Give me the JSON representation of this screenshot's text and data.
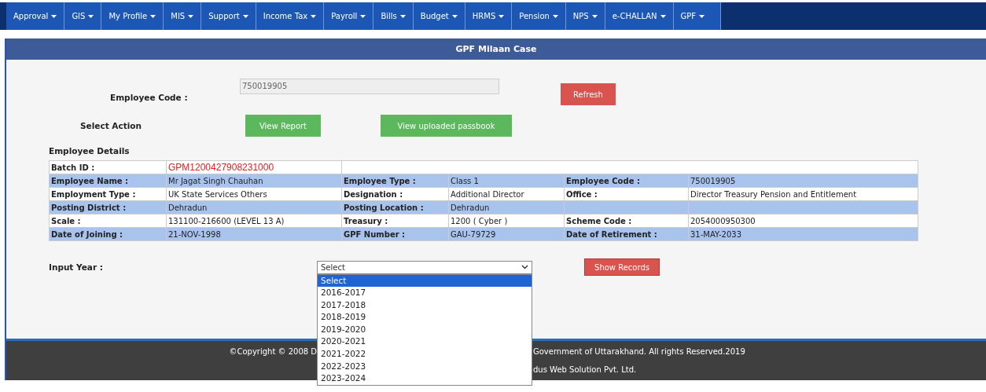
{
  "nav": [
    {
      "label": "Approval"
    },
    {
      "label": "GIS"
    },
    {
      "label": "My Profile"
    },
    {
      "label": "MIS"
    },
    {
      "label": "Support"
    },
    {
      "label": "Income Tax"
    },
    {
      "label": "Payroll"
    },
    {
      "label": "Bills"
    },
    {
      "label": "Budget"
    },
    {
      "label": "HRMS"
    },
    {
      "label": "Pension"
    },
    {
      "label": "NPS"
    },
    {
      "label": "e-CHALLAN"
    },
    {
      "label": "GPF"
    }
  ],
  "page_title": "GPF Milaan Case",
  "employee_code": {
    "label": "Employee Code :",
    "value": "750019905"
  },
  "refresh_button": "Refresh",
  "select_action": {
    "label": "Select Action",
    "buttons": [
      "View Report",
      "View uploaded passbook"
    ]
  },
  "details": {
    "heading": "Employee Details",
    "batch": {
      "label": "Batch ID :",
      "value": "GPM1200427908231000"
    },
    "rows": [
      {
        "cells": [
          "Employee Name :",
          "Mr Jagat Singh Chauhan",
          "Employee Type :",
          "Class 1",
          "Employee Code :",
          "750019905"
        ]
      },
      {
        "cells": [
          "Employment Type :",
          "UK State Services Others",
          "Designation :",
          "Additional Director",
          "Office :",
          "Director Treasury Pension and Entitlement"
        ]
      },
      {
        "cells": [
          "Posting District :",
          "Dehradun",
          "Posting Location :",
          "Dehradun",
          "",
          ""
        ]
      },
      {
        "cells": [
          "Scale :",
          "131100-216600 (LEVEL 13 A)",
          "Treasury :",
          "1200 ( Cyber )",
          "Scheme Code :",
          "2054000950300"
        ]
      },
      {
        "cells": [
          "Date of Joining :",
          "21-NOV-1998",
          "GPF Number :",
          "GAU-79729",
          "Date of Retirement :",
          "31-MAY-2033"
        ]
      }
    ]
  },
  "input_year": {
    "label": "Input Year :",
    "value": "Select",
    "expanded": true,
    "options": [
      {
        "label": "Select",
        "selected": true
      },
      {
        "label": "2016-2017",
        "selected": false
      },
      {
        "label": "2017-2018",
        "selected": false
      },
      {
        "label": "2018-2019",
        "selected": false
      },
      {
        "label": "2019-2020",
        "selected": false
      },
      {
        "label": "2020-2021",
        "selected": false
      },
      {
        "label": "2021-2022",
        "selected": false
      },
      {
        "label": "2022-2023",
        "selected": false
      },
      {
        "label": "2023-2024",
        "selected": false
      }
    ]
  },
  "show_records_button": "Show Records",
  "footer": {
    "line_1_left": "©Copyright © 2008 D",
    "line_1_right": "Government of Uttarakhand. All rights Reserved.2019",
    "line_2_right": "dus Web Solution Pvt. Ltd."
  }
}
